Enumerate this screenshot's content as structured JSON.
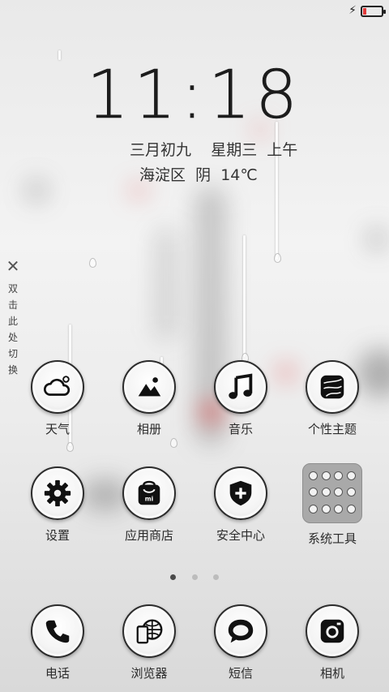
{
  "status": {
    "battery_color": "#e23b3b",
    "battery_level": 0.15,
    "charging_icon": "bolt-icon"
  },
  "clock": {
    "time": "11:18"
  },
  "date": {
    "lunar": "三月初九",
    "weekday": "星期三",
    "period": "上午"
  },
  "weather": {
    "location": "海淀区",
    "condition": "阴",
    "temperature": "14℃"
  },
  "switch": {
    "chars": [
      "双",
      "击",
      "此",
      "处",
      "切",
      "换"
    ]
  },
  "apps": [
    {
      "label": "天气",
      "icon": "weather-icon"
    },
    {
      "label": "相册",
      "icon": "gallery-icon"
    },
    {
      "label": "音乐",
      "icon": "music-icon"
    },
    {
      "label": "个性主题",
      "icon": "themes-icon"
    },
    {
      "label": "设置",
      "icon": "settings-icon"
    },
    {
      "label": "应用商店",
      "icon": "app-store-icon"
    },
    {
      "label": "安全中心",
      "icon": "security-icon"
    },
    {
      "label": "系统工具",
      "icon": "folder-icon"
    }
  ],
  "pager": {
    "count": 3,
    "active": 1
  },
  "dock": [
    {
      "label": "电话",
      "icon": "phone-icon"
    },
    {
      "label": "浏览器",
      "icon": "browser-icon"
    },
    {
      "label": "短信",
      "icon": "messages-icon"
    },
    {
      "label": "相机",
      "icon": "camera-icon"
    }
  ]
}
